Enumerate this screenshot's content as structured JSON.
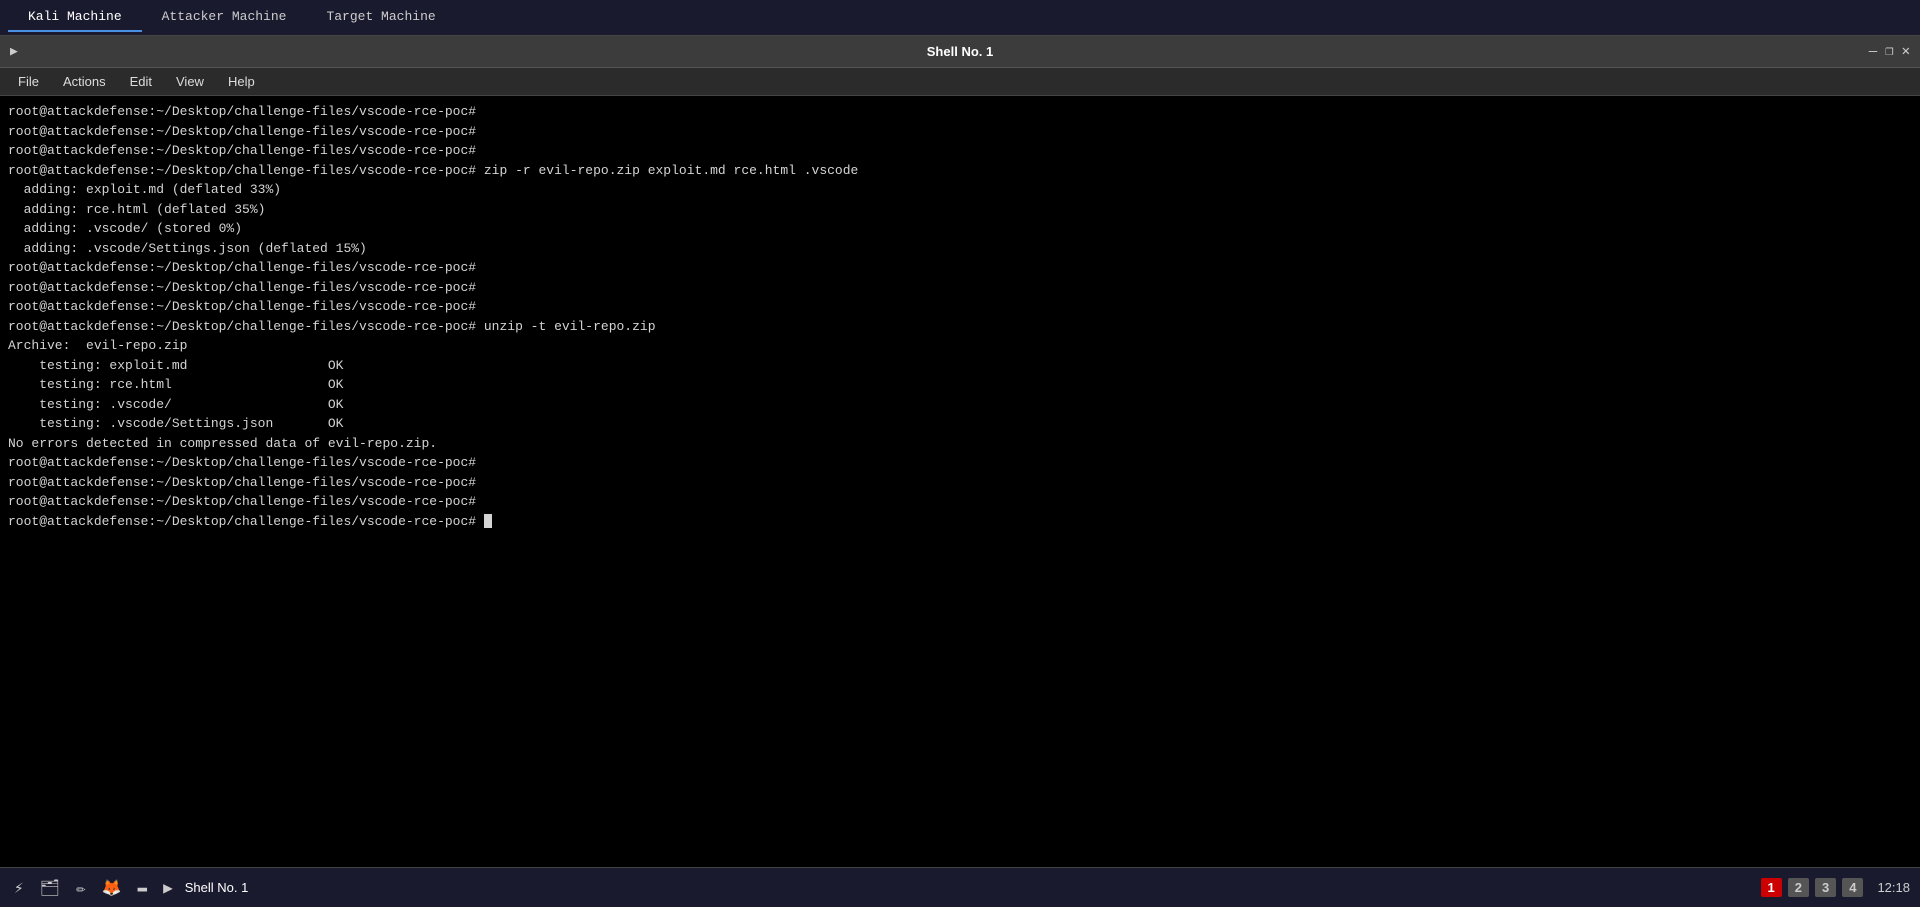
{
  "tabs": [
    {
      "id": "kali",
      "label": "Kali Machine",
      "active": true
    },
    {
      "id": "attacker",
      "label": "Attacker Machine",
      "active": false
    },
    {
      "id": "target",
      "label": "Target Machine",
      "active": false
    }
  ],
  "titlebar": {
    "title": "Shell No. 1",
    "shell_icon": "▶",
    "minimize": "—",
    "restore": "❐",
    "close": "✕"
  },
  "menubar": {
    "items": [
      "File",
      "Actions",
      "Edit",
      "View",
      "Help"
    ]
  },
  "terminal": {
    "lines": [
      "root@attackdefense:~/Desktop/challenge-files/vscode-rce-poc#",
      "root@attackdefense:~/Desktop/challenge-files/vscode-rce-poc#",
      "root@attackdefense:~/Desktop/challenge-files/vscode-rce-poc#",
      "root@attackdefense:~/Desktop/challenge-files/vscode-rce-poc# zip -r evil-repo.zip exploit.md rce.html .vscode",
      "  adding: exploit.md (deflated 33%)",
      "  adding: rce.html (deflated 35%)",
      "  adding: .vscode/ (stored 0%)",
      "  adding: .vscode/Settings.json (deflated 15%)",
      "root@attackdefense:~/Desktop/challenge-files/vscode-rce-poc#",
      "root@attackdefense:~/Desktop/challenge-files/vscode-rce-poc#",
      "root@attackdefense:~/Desktop/challenge-files/vscode-rce-poc#",
      "root@attackdefense:~/Desktop/challenge-files/vscode-rce-poc# unzip -t evil-repo.zip",
      "Archive:  evil-repo.zip",
      "    testing: exploit.md                  OK",
      "    testing: rce.html                    OK",
      "    testing: .vscode/                    OK",
      "    testing: .vscode/Settings.json       OK",
      "No errors detected in compressed data of evil-repo.zip.",
      "root@attackdefense:~/Desktop/challenge-files/vscode-rce-poc#",
      "root@attackdefense:~/Desktop/challenge-files/vscode-rce-poc#",
      "root@attackdefense:~/Desktop/challenge-files/vscode-rce-poc#",
      "root@attackdefense:~/Desktop/challenge-files/vscode-rce-poc# "
    ],
    "last_line_has_cursor": true
  },
  "taskbar": {
    "icons": [
      {
        "id": "network",
        "symbol": "⚡"
      },
      {
        "id": "files",
        "symbol": "📁"
      },
      {
        "id": "editor",
        "symbol": "✏"
      },
      {
        "id": "firefox",
        "symbol": "🦊"
      },
      {
        "id": "terminal",
        "symbol": "⬛"
      },
      {
        "id": "shell",
        "symbol": "▶"
      }
    ],
    "shell_label": "Shell No. 1",
    "pages": [
      "1",
      "2",
      "3",
      "4"
    ],
    "active_page": "1",
    "time": "12:18"
  }
}
